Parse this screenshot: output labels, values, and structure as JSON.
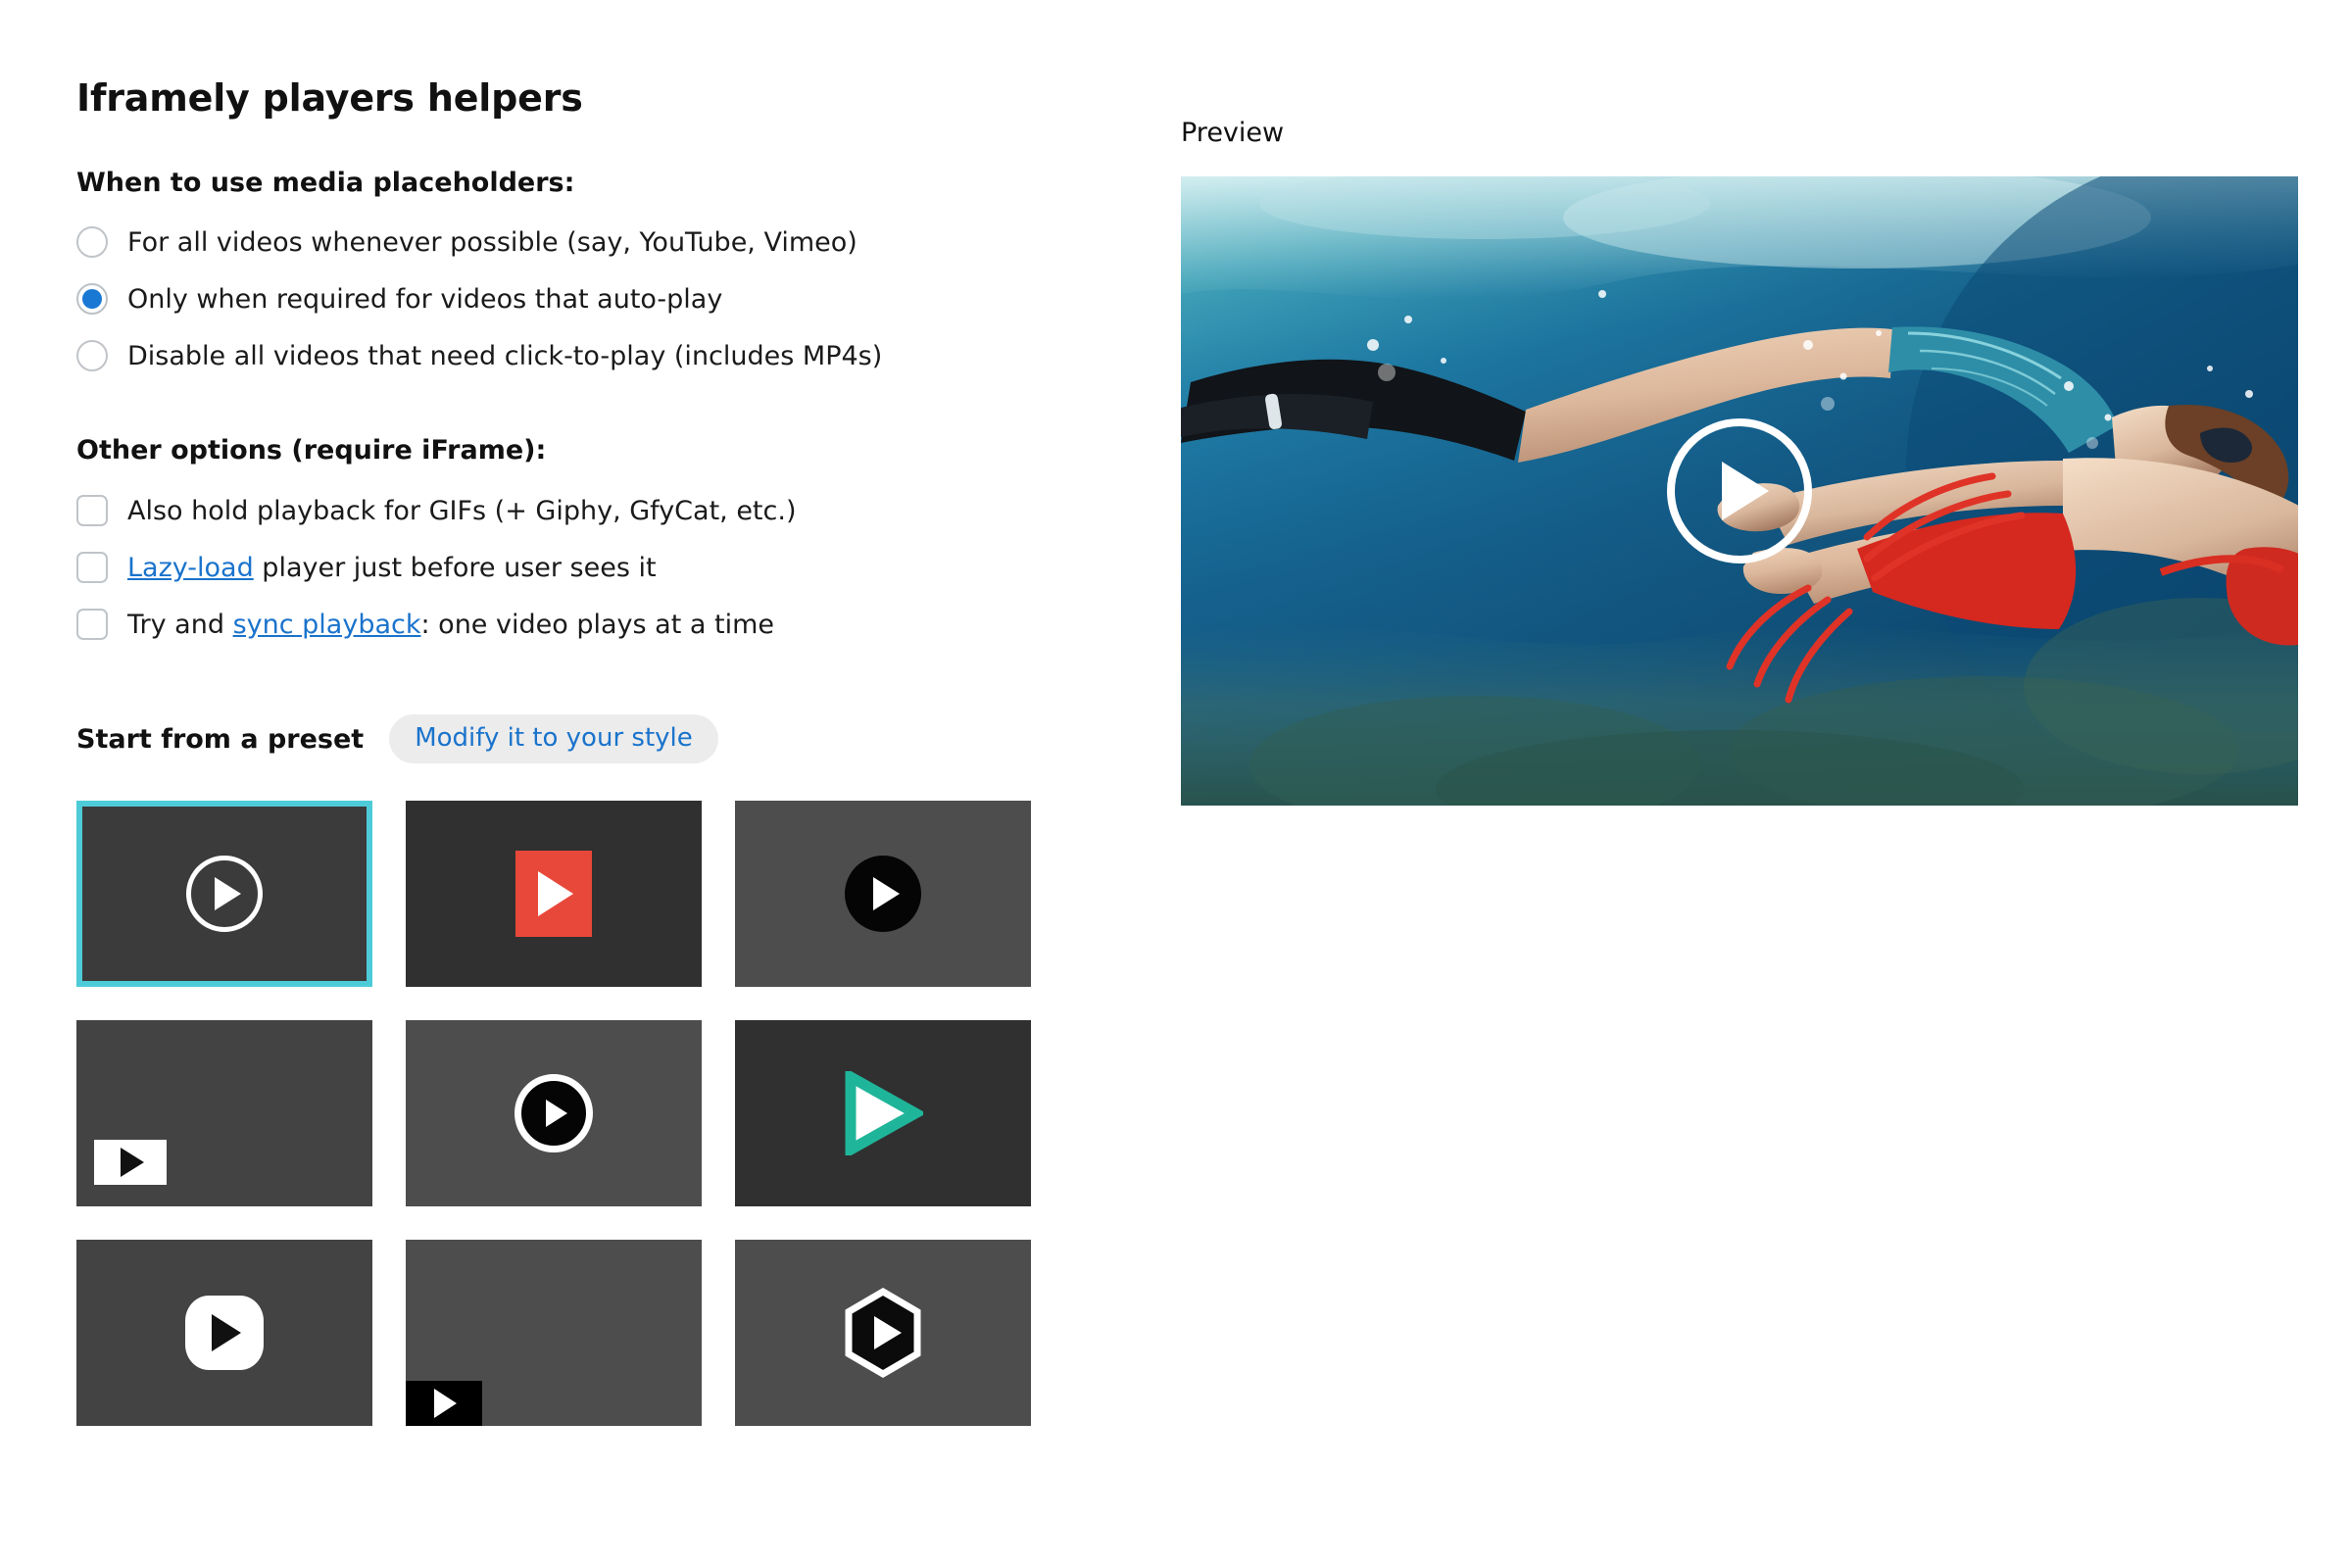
{
  "page": {
    "title": "Iframely players helpers"
  },
  "placeholders": {
    "heading": "When to use media placeholders:",
    "options": [
      {
        "label": "For all videos whenever possible (say, YouTube, Vimeo)",
        "checked": false
      },
      {
        "label": "Only when required for videos that auto-play",
        "checked": true
      },
      {
        "label": "Disable all videos that need click-to-play (includes MP4s)",
        "checked": false
      }
    ]
  },
  "other_options": {
    "heading": "Other options (require iFrame):",
    "items": [
      {
        "text_before": "",
        "link": "",
        "text_after": "Also hold playback for GIFs (+ Giphy, GfyCat, etc.)",
        "checked": false
      },
      {
        "text_before": "",
        "link": "Lazy-load",
        "text_after": " player just before user sees it",
        "checked": false
      },
      {
        "text_before": "Try and ",
        "link": "sync playback",
        "text_after": ": one video plays at a time",
        "checked": false
      }
    ]
  },
  "presets": {
    "label": "Start from a preset",
    "pill_label": "Modify it to your style",
    "selected_index": 0,
    "tiles": [
      {
        "name": "preset-circle-outline",
        "bg": "#3b3b3b",
        "style": "ring-thin"
      },
      {
        "name": "preset-red-square",
        "bg": "#303030",
        "style": "red-square"
      },
      {
        "name": "preset-black-disc",
        "bg": "#4d4d4d",
        "style": "black-disc"
      },
      {
        "name": "preset-white-tab-corner",
        "bg": "#434343",
        "style": "white-rect-bl"
      },
      {
        "name": "preset-black-disc-ring",
        "bg": "#4d4d4d",
        "style": "black-disc-ring"
      },
      {
        "name": "preset-teal-triangle",
        "bg": "#303030",
        "style": "teal-triangle"
      },
      {
        "name": "preset-white-squircle",
        "bg": "#434343",
        "style": "white-squircle"
      },
      {
        "name": "preset-black-tab-corner",
        "bg": "#4d4d4d",
        "style": "black-rect-bl"
      },
      {
        "name": "preset-hexagon",
        "bg": "#4d4d4d",
        "style": "hexagon"
      }
    ]
  },
  "preview": {
    "label": "Preview",
    "play_button": "play-icon"
  },
  "colors": {
    "accent_blue": "#1878d4",
    "link_blue": "#1a73cc",
    "selected_border": "#4ecbd8",
    "pill_bg": "#ececec",
    "red": "#e8483a",
    "teal": "#1fb59a"
  }
}
